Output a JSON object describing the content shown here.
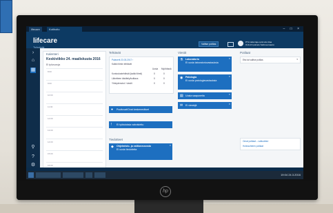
{
  "app": {
    "title_tab": "lifecare",
    "second_tab": "Kotihoito",
    "logo": "lifecare",
    "logo_sub": "Työpöytä",
    "header_button": "Valitse potilas",
    "user_line1": "PTH tallentaja optimoitu tilaa",
    "user_line2": "OULUN palvelu Sallmaa kaavio",
    "window_controls": "– □ ×"
  },
  "calendar": {
    "heading": "Kalenteri",
    "date": "Keskiviikko 24. maaliskuuta 2016",
    "sub": "Ei työvuoroja",
    "times": [
      "8:00",
      "9:00",
      "10:00",
      "11:00",
      "12:00",
      "13:00",
      "14:00",
      "15:00",
      "16:00"
    ]
  },
  "tasks": {
    "heading": "Tehtävät",
    "date_line": "Palaverit 23.03.2017 ›",
    "caption": "Kaikki tiimin tehtävät",
    "col1": "Uusia",
    "col2": "Myöhässä",
    "rows": [
      {
        "label": "Kuntoutustehtävät (kaikki tiimit)",
        "a": "0",
        "b": "0"
      },
      {
        "label": "Lähetteen käsittely/kuittaus",
        "a": "0",
        "b": "0"
      },
      {
        "label": "Yhteydenotot / viestit",
        "a": "0",
        "b": "0"
      }
    ],
    "btn1": "Puuttuvat/Ovat keskeneräiset",
    "btn2": "Ei työtuloksia vahvistettu",
    "section2": "Tiedotteet",
    "info_title": "Ohjelmisto- ja valtioneuvosto",
    "info_text": "Ei uusia tiedotteita"
  },
  "messages": {
    "heading": "Viestit",
    "items": [
      {
        "title": "Laboratorio",
        "text": "Ei uusia laboratoriovastauksia"
      },
      {
        "title": "Patologia",
        "text": "Ei uusia patologiavastauksia"
      },
      {
        "title": "Uusia saapuneita",
        "text": ""
      },
      {
        "title": "Ei viestejä",
        "text": ""
      }
    ]
  },
  "patients": {
    "heading": "Potilaat",
    "filter": "Etsi tai valitse potilas",
    "link1": "Omat potilaat – valtuutetut",
    "link2": "Hoitosuhteen potilaat"
  },
  "taskbar": {
    "clock": "19:04 24.3.2016"
  },
  "colors": {
    "primary": "#1d6fc0",
    "header": "#0d3a63",
    "nav": "#0f2d4a"
  }
}
